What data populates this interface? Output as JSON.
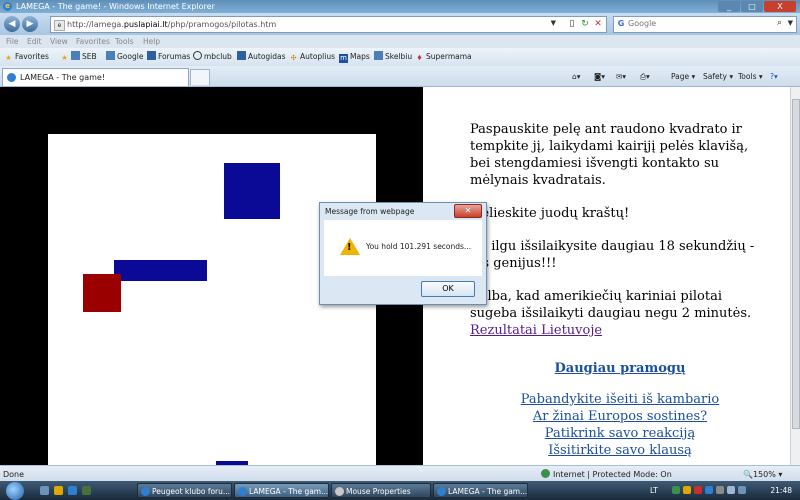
{
  "window": {
    "title": "LAMEGA - The game! - Windows Internet Explorer",
    "controls": [
      "_",
      "□",
      "X"
    ]
  },
  "address": {
    "url_prefix": "http://lamega.",
    "url_domain": "puslapiai.lt",
    "url_path": "/php/pramogos/pilotas.htm"
  },
  "search": {
    "placeholder": "Google"
  },
  "menu": [
    "File",
    "Edit",
    "View",
    "Favorites",
    "Tools",
    "Help"
  ],
  "favorites": {
    "label": "Favorites",
    "items": [
      "SEB",
      "Google",
      "Forumas",
      "mbclub",
      "Autogidas",
      "Autoplius",
      "Maps",
      "Skelbiu",
      "Supermama"
    ]
  },
  "tab": {
    "label": "LAMEGA - The game!"
  },
  "commands": {
    "page": "Page",
    "safety": "Safety",
    "tools": "Tools"
  },
  "game": {
    "colors": {
      "border": "#000000",
      "field": "#ffffff",
      "blue": "#0a0a96",
      "red": "#9a0000"
    }
  },
  "page": {
    "instructions": "Paspauskite pelę ant raudono kvadrato ir tempkite jį, laikydami kairįjį pelės klavišą, bei stengdamiesi išvengti kontakto su mėlynais kvadratais.",
    "warning": "Nelieskite juodų kraštų!",
    "challenge": "Jei ilgu išsilaikysite daugiau 18 sekundžių - jus genijus!!!",
    "fact": "Kalba, kad amerikiečių kariniai pilotai sugeba išsilaikyti daugiau negu 2 minutės.",
    "results_link": "Rezultatai Lietuvoje",
    "more_heading": "Daugiau pramogų",
    "links": [
      "Pabandykite išeiti iš kambario",
      "Ar žinai Europos sostines?",
      "Patikrink savo reakciją",
      "Išsitirkite savo klausą"
    ]
  },
  "dialog": {
    "title": "Message from webpage",
    "message": "You hold 101.291 seconds...",
    "ok": "OK"
  },
  "status": {
    "done": "Done",
    "zone": "Internet | Protected Mode: On",
    "zoom": "150%"
  },
  "taskbar": {
    "tasks": [
      "Peugeot klubo foru...",
      "LAMEGA - The gam...",
      "Mouse Properties",
      "LAMEGA - The gam..."
    ],
    "lang": "LT",
    "clock": "21:48"
  }
}
